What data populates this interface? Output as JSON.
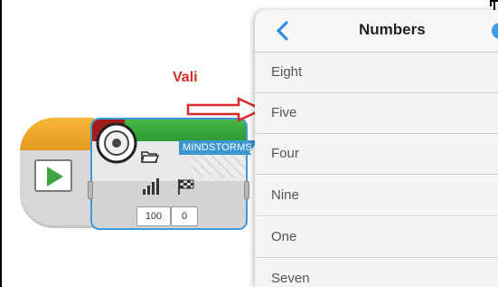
{
  "annotation": {
    "label": "Vali"
  },
  "block": {
    "brand_label": "MINDSTORMS",
    "volume_value": "100",
    "play_type_value": "0"
  },
  "popover": {
    "title": "Numbers",
    "items": [
      {
        "label": "Eight"
      },
      {
        "label": "Five"
      },
      {
        "label": "Four"
      },
      {
        "label": "Nine"
      },
      {
        "label": "One"
      },
      {
        "label": "Seven"
      }
    ]
  },
  "colors": {
    "accent_blue": "#3f9be2",
    "annotation_red": "#d82a2a",
    "block_green": "#2f9a32",
    "start_orange": "#f6b638"
  }
}
